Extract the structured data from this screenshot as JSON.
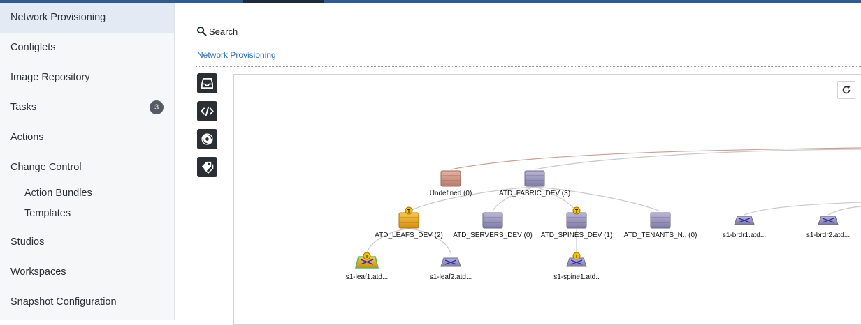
{
  "sidebar": {
    "items": [
      {
        "label": "Network Provisioning"
      },
      {
        "label": "Configlets"
      },
      {
        "label": "Image Repository"
      },
      {
        "label": "Tasks",
        "badge": "3"
      },
      {
        "label": "Actions"
      },
      {
        "label": "Change Control"
      },
      {
        "label": "Action Bundles"
      },
      {
        "label": "Templates"
      },
      {
        "label": "Studios"
      },
      {
        "label": "Workspaces"
      },
      {
        "label": "Snapshot Configuration"
      }
    ]
  },
  "search": {
    "placeholder": "Search"
  },
  "breadcrumb": {
    "label": "Network Provisioning"
  },
  "toolbar": {
    "icons": [
      "inbox-icon",
      "code-icon",
      "disc-icon",
      "tags-icon"
    ]
  },
  "topology": {
    "nodes": {
      "undefined": "Undefined (0)",
      "fabric": "ATD_FABRIC_DEV (3)",
      "leafs": "ATD_LEAFS_DEV (2)",
      "servers": "ATD_SERVERS_DEV (0)",
      "spines": "ATD_SPINES_DEV (1)",
      "tenants": "ATD_TENANTS_N.. (0)",
      "brdr1": "s1-brdr1.atd...",
      "brdr2": "s1-brdr2.atd...",
      "leaf1": "s1-leaf1.atd...",
      "leaf2": "s1-leaf2.atd...",
      "spine1": "s1-spine1.atd.."
    },
    "task_marker": "T"
  },
  "colors": {
    "accent": "#2f5b8e",
    "link": "#2a6db5",
    "container_purple": "#8f8aae",
    "container_undefined": "#c88e7e",
    "container_task": "#e8a417"
  }
}
